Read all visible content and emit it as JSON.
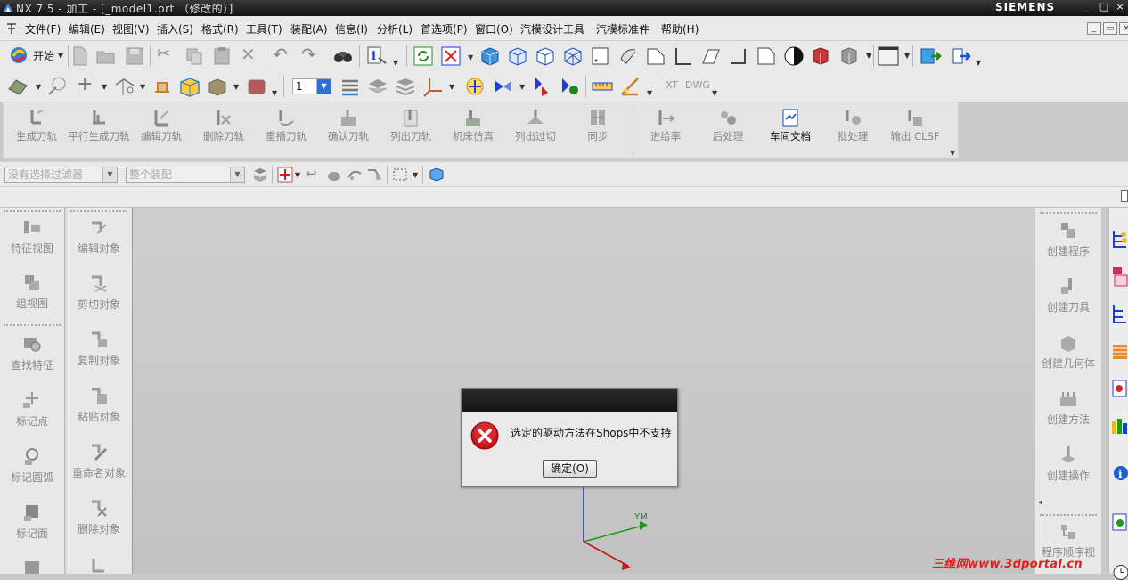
{
  "window": {
    "title": "NX 7.5 - 加工 - [_model1.prt （修改的）]",
    "brand": "SIEMENS",
    "controls": [
      "_",
      "□",
      "×"
    ]
  },
  "menubar": {
    "items": [
      "文件(F)",
      "编辑(E)",
      "视图(V)",
      "插入(S)",
      "格式(R)",
      "工具(T)",
      "装配(A)",
      "信息(I)",
      "分析(L)",
      "首选项(P)",
      "窗口(O)",
      "汽模设计工具",
      "汽模标准件",
      "帮助(H)"
    ]
  },
  "standard_toolbar": {
    "start_label": "开始",
    "layer_value": "1",
    "xt_label": "XT",
    "dwg_label": "DWG"
  },
  "operation_toolbar": {
    "buttons": [
      "生成刀轨",
      "平行生成刀轨",
      "编辑刀轨",
      "删除刀轨",
      "重播刀轨",
      "确认刀轨",
      "列出刀轨",
      "机床仿真",
      "列出过切",
      "同步",
      "进给率",
      "后处理",
      "车间文档",
      "批处理",
      "输出 CLSF"
    ]
  },
  "selection_bar": {
    "filter_placeholder": "没有选择过滤器",
    "scope_placeholder": "整个装配"
  },
  "left_palette_1": {
    "items": [
      "特征视图",
      "组视图",
      "查找特征",
      "标记点",
      "标记圆弧",
      "标记面"
    ]
  },
  "left_palette_2": {
    "items": [
      "编辑对象",
      "剪切对象",
      "复制对象",
      "粘贴对象",
      "重命名对象",
      "删除对象"
    ]
  },
  "right_palette": {
    "items": [
      "创建程序",
      "创建刀具",
      "创建几何体",
      "创建方法",
      "创建操作",
      "程序顺序视"
    ]
  },
  "triad": {
    "ym_label": "YM"
  },
  "dialog": {
    "message": "选定的驱动方法在Shops中不支持",
    "ok_label": "确定(O)"
  },
  "watermark": "三维网www.3dportal.cn",
  "colors": {
    "accent_error": "#d42020",
    "axis_green": "#1d9a1d",
    "axis_blue": "#1a3fd0",
    "axis_red": "#c01818"
  }
}
